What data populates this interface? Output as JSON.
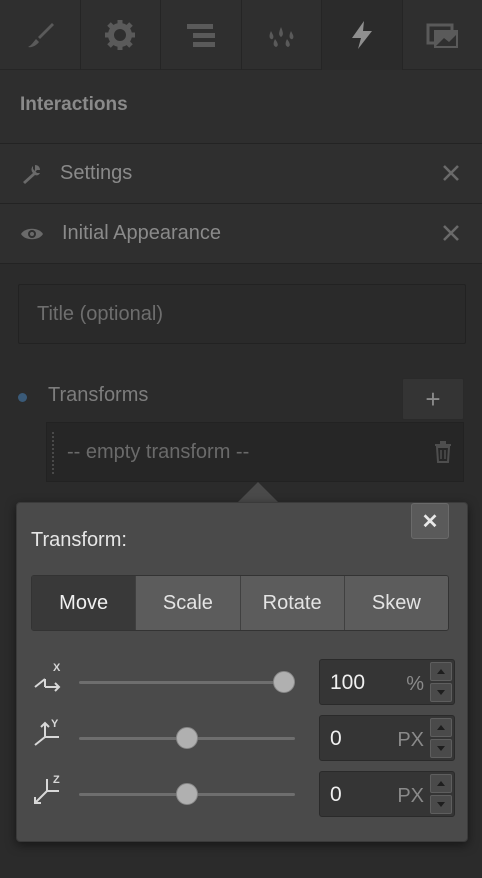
{
  "toolbar": {
    "tabs": [
      {
        "icon": "brush-icon",
        "active": false
      },
      {
        "icon": "gear-icon",
        "active": false
      },
      {
        "icon": "align-lines-icon",
        "active": false
      },
      {
        "icon": "drops-icon",
        "active": false
      },
      {
        "icon": "lightning-icon",
        "active": true
      },
      {
        "icon": "image-assets-icon",
        "active": false
      }
    ]
  },
  "panel": {
    "title": "Interactions",
    "sections": [
      {
        "label": "Settings",
        "icon": "wrench-icon"
      },
      {
        "label": "Initial Appearance",
        "icon": "eye-icon"
      }
    ],
    "title_input": {
      "placeholder": "Title (optional)"
    },
    "transforms": {
      "label": "Transforms",
      "add_label": "+",
      "items": [
        {
          "label": "-- empty transform --"
        }
      ]
    }
  },
  "popover": {
    "title": "Transform:",
    "close_label": "✕",
    "modes": [
      {
        "label": "Move",
        "active": true
      },
      {
        "label": "Scale",
        "active": false
      },
      {
        "label": "Rotate",
        "active": false
      },
      {
        "label": "Skew",
        "active": false
      }
    ],
    "axes": [
      {
        "axis": "X",
        "value": "100",
        "unit": "%",
        "slider_fraction": 1.0
      },
      {
        "axis": "Y",
        "value": "0",
        "unit": "PX",
        "slider_fraction": 0.5
      },
      {
        "axis": "Z",
        "value": "0",
        "unit": "PX",
        "slider_fraction": 0.5
      }
    ]
  },
  "colors": {
    "background": "#2b2b2b",
    "popover": "#4a4a4a",
    "accent_dot": "#3a5a78"
  }
}
